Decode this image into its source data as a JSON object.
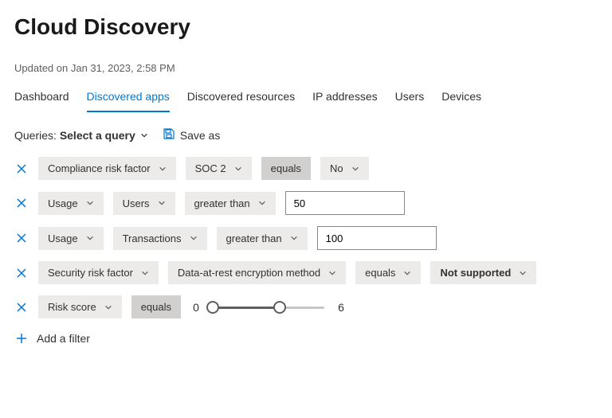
{
  "header": {
    "title": "Cloud Discovery"
  },
  "updated": "Updated on Jan 31, 2023, 2:58 PM",
  "tabs": [
    {
      "label": "Dashboard"
    },
    {
      "label": "Discovered apps"
    },
    {
      "label": "Discovered resources"
    },
    {
      "label": "IP addresses"
    },
    {
      "label": "Users"
    },
    {
      "label": "Devices"
    }
  ],
  "active_tab_index": 1,
  "queries": {
    "label": "Queries:",
    "select_label": "Select a query",
    "save_as_label": "Save as"
  },
  "filters": [
    {
      "field": "Compliance risk factor",
      "sub": "SOC 2",
      "op": "equals",
      "op_dark": true,
      "value_chip": "No"
    },
    {
      "field": "Usage",
      "sub": "Users",
      "op": "greater than",
      "value_input": "50"
    },
    {
      "field": "Usage",
      "sub": "Transactions",
      "op": "greater than",
      "value_input": "100"
    },
    {
      "field": "Security risk factor",
      "sub": "Data-at-rest encryption method",
      "op": "equals",
      "value_chip": "Not supported",
      "value_bold": true
    },
    {
      "field": "Risk score",
      "op": "equals",
      "op_dark": true,
      "range": {
        "min": 0,
        "max": 6,
        "scale_max": 10
      }
    }
  ],
  "add_filter_label": "Add a filter"
}
